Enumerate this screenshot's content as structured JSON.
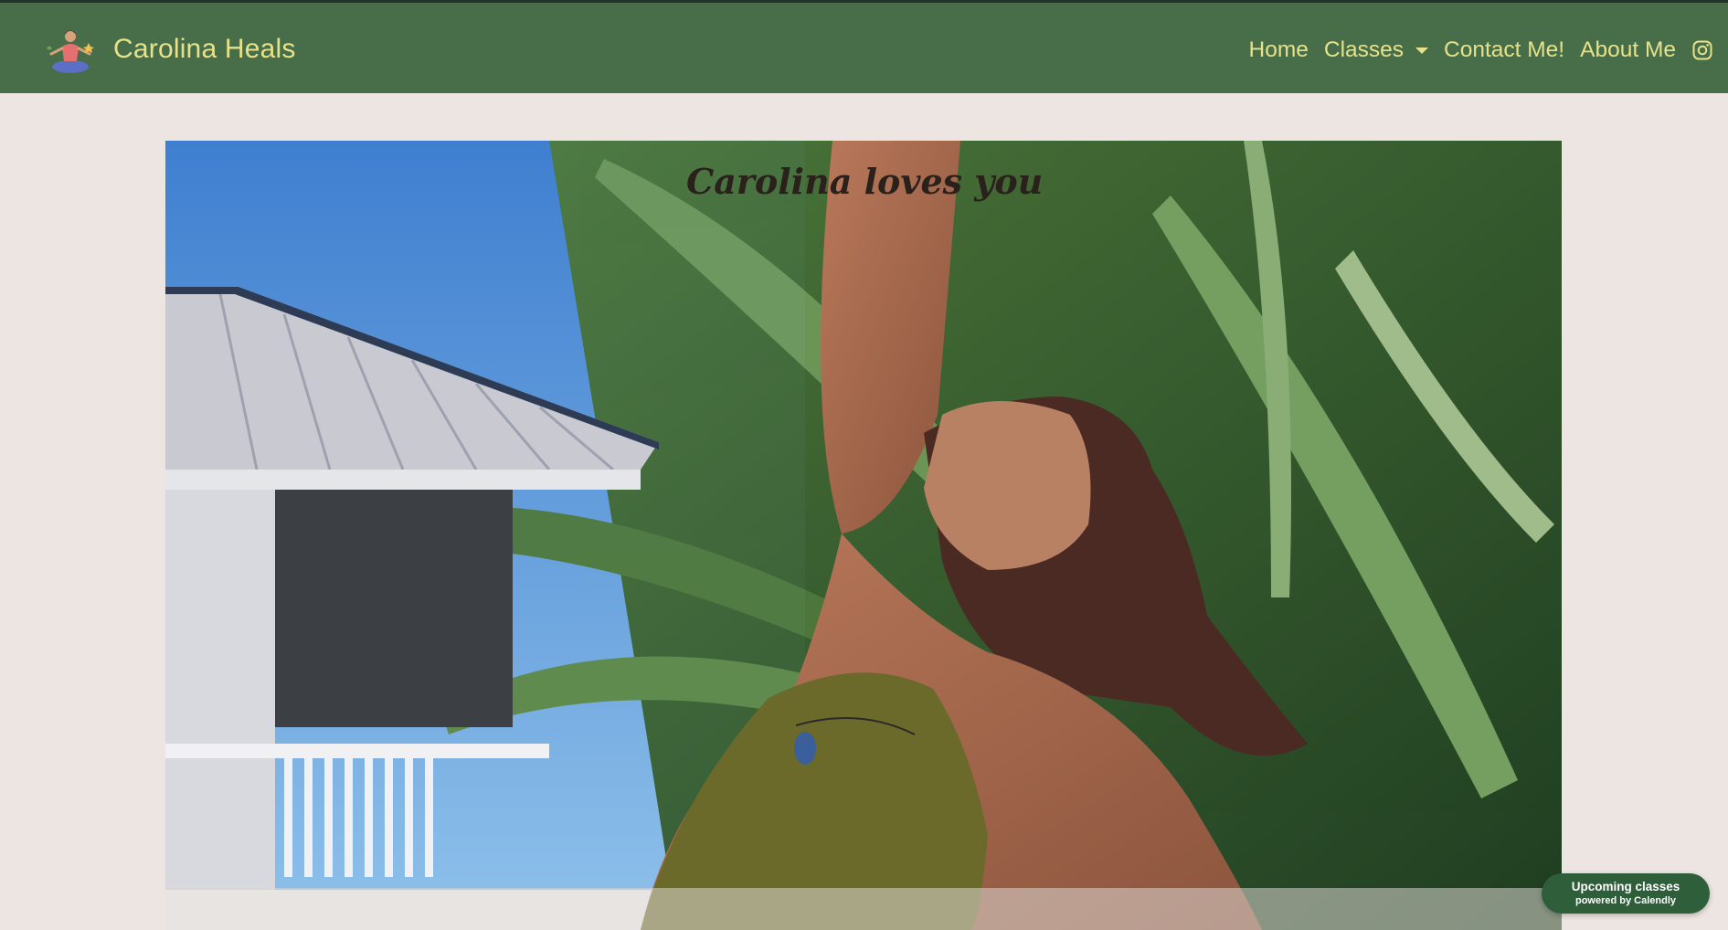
{
  "brand": {
    "name": "Carolina Heals",
    "logo_icon": "meditation-yoga-logo-icon"
  },
  "nav": {
    "home": "Home",
    "classes": "Classes",
    "contact": "Contact Me!",
    "about": "About Me",
    "instagram_icon": "instagram-icon"
  },
  "hero": {
    "caption": "Carolina loves you"
  },
  "calendly": {
    "title": "Upcoming classes",
    "subtitle": "powered by Calendly"
  },
  "colors": {
    "navbar": "#476d49",
    "nav_text": "#e6e28a",
    "page_background": "#ede5e1",
    "calendly_badge": "#2f5e3b"
  }
}
